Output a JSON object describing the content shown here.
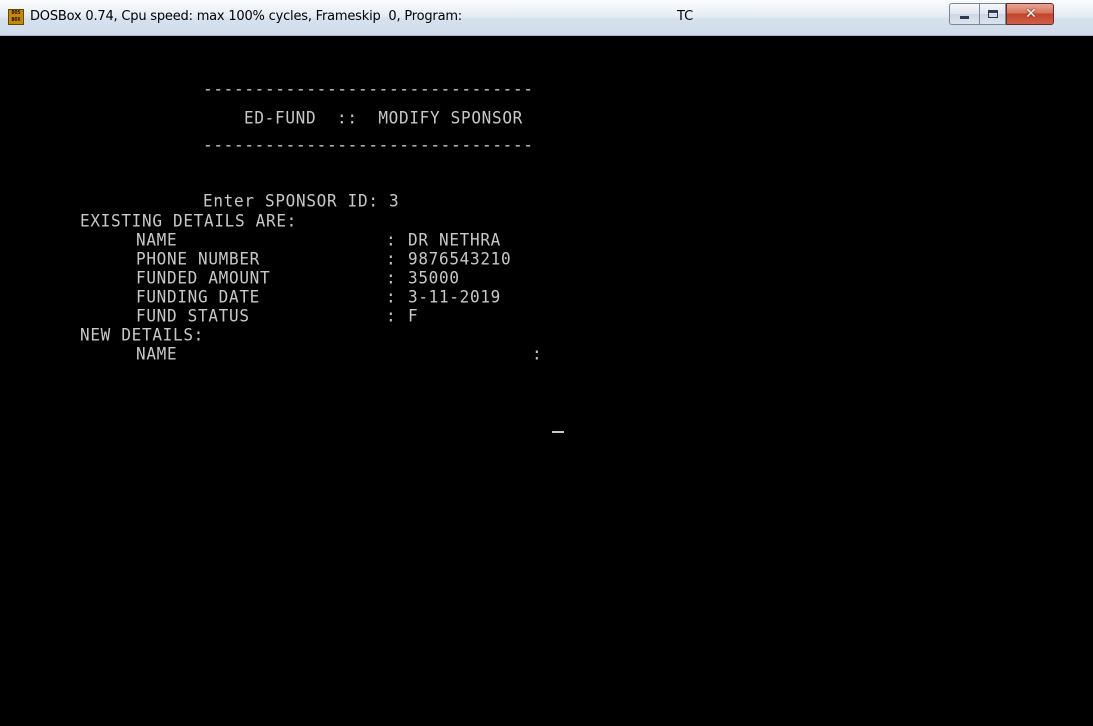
{
  "window": {
    "title": "DOSBox 0.74, Cpu speed: max 100% cycles, Frameskip  0, Program:",
    "program": "TC",
    "icon_text": [
      "DOS",
      "BOX"
    ],
    "icon_name": "dosbox-app-icon",
    "controls": {
      "minimize_icon": "minimize-icon",
      "maximize_icon": "maximize-icon",
      "close_icon": "close-icon",
      "close_glyph": "✕"
    }
  },
  "screen": {
    "rule_top": "--------------------------------",
    "heading": "ED-FUND  ::  MODIFY SPONSOR",
    "rule_bottom": "--------------------------------",
    "prompt_label": "Enter SPONSOR ID:",
    "prompt_value": "3",
    "existing_heading": "EXISTING DETAILS ARE:",
    "existing": [
      {
        "label": "NAME",
        "sep": ":",
        "value": "DR NETHRA"
      },
      {
        "label": "PHONE NUMBER",
        "sep": ":",
        "value": "9876543210"
      },
      {
        "label": "FUNDED AMOUNT",
        "sep": ":",
        "value": "35000"
      },
      {
        "label": "FUNDING DATE",
        "sep": ":",
        "value": "3-11-2019"
      },
      {
        "label": "FUND STATUS",
        "sep": ":",
        "value": "F"
      }
    ],
    "new_heading": "NEW DETAILS:",
    "new_fields": [
      {
        "label": "NAME",
        "sep": ":",
        "value": ""
      }
    ]
  },
  "colors": {
    "terminal_bg": "#000000",
    "terminal_fg": "#c8c8c8",
    "close_button": "#c2452b"
  }
}
